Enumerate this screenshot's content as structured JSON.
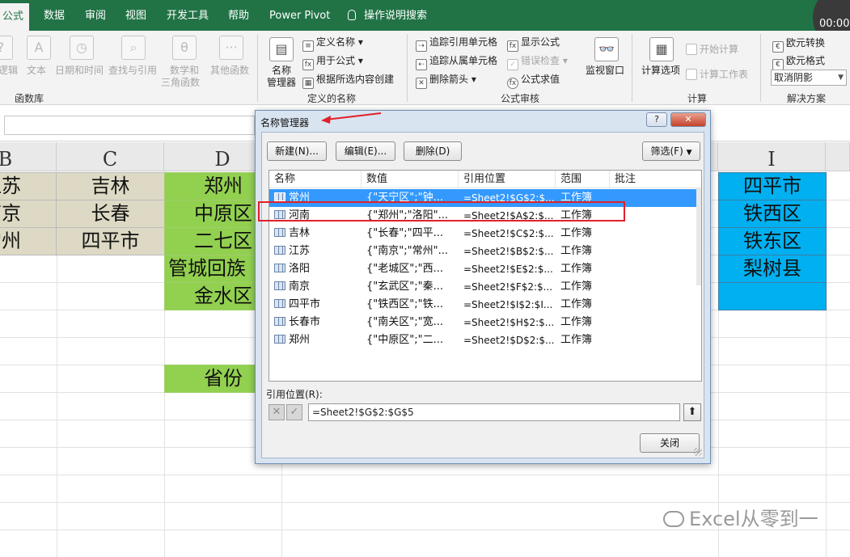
{
  "tabs": [
    {
      "label": "公式",
      "active": true
    },
    {
      "label": "数据"
    },
    {
      "label": "审阅"
    },
    {
      "label": "视图"
    },
    {
      "label": "开发工具"
    },
    {
      "label": "帮助"
    },
    {
      "label": "Power Pivot"
    },
    {
      "label": "操作说明搜索"
    }
  ],
  "timer": "00:00",
  "ribbon": {
    "function_library": {
      "group_label": "函数库",
      "logical": "逻辑",
      "text": "文本",
      "datetime": "日期和时间",
      "lookup": "查找与引用",
      "math": "数学和",
      "math2": "三角函数",
      "other": "其他函数"
    },
    "defined_names": {
      "group_label": "定义的名称",
      "name_manager": "名称",
      "name_manager2": "管理器",
      "define_name": "定义名称",
      "use_in_formula": "用于公式",
      "create_from_selection": "根据所选内容创建"
    },
    "formula_auditing": {
      "group_label": "公式审核",
      "trace_precedents": "追踪引用单元格",
      "trace_dependents": "追踪从属单元格",
      "remove_arrows": "删除箭头",
      "show_formulas": "显示公式",
      "error_checking": "错误检查",
      "evaluate_formula": "公式求值",
      "watch_window": "监视窗口"
    },
    "calculation": {
      "group_label": "计算",
      "calc_options": "计算选项",
      "calc_now": "开始计算",
      "calc_sheet": "计算工作表"
    },
    "solutions": {
      "group_label": "解决方案",
      "euro_convert": "欧元转换",
      "euro_format": "欧元格式",
      "cancel_shadow": "取消阴影"
    }
  },
  "sheet": {
    "columns": [
      "B",
      "C",
      "D",
      "I"
    ],
    "col_b": [
      "江苏",
      "南京",
      "常州"
    ],
    "col_c": [
      "吉林",
      "长春",
      "四平市"
    ],
    "col_d": [
      "郑州",
      "中原区",
      "二七区",
      "管城回族",
      "金水区"
    ],
    "col_i": [
      "四平市",
      "铁西区",
      "铁东区",
      "梨树县"
    ],
    "province_label": "省份",
    "colors": {
      "tan": "#ddd9c4",
      "green": "#92d050",
      "blue": "#00b0f0"
    }
  },
  "watermark": "Excel从零到一",
  "dialog": {
    "title": "名称管理器",
    "help": "?",
    "close": "✕",
    "new_btn": "新建(N)...",
    "edit_btn": "编辑(E)...",
    "delete_btn": "删除(D)",
    "filter_btn": "筛选(F)",
    "headers": {
      "name": "名称",
      "value": "数值",
      "refers": "引用位置",
      "scope": "范围",
      "comment": "批注"
    },
    "rows": [
      {
        "name": "常州",
        "value": "{\"天宁区\";\"钟...",
        "refers": "=Sheet2!$G$2:$...",
        "scope": "工作簿",
        "selected": true
      },
      {
        "name": "河南",
        "value": "{\"郑州\";\"洛阳\"...",
        "refers": "=Sheet2!$A$2:$...",
        "scope": "工作簿"
      },
      {
        "name": "吉林",
        "value": "{\"长春\";\"四平...",
        "refers": "=Sheet2!$C$2:$...",
        "scope": "工作簿"
      },
      {
        "name": "江苏",
        "value": "{\"南京\";\"常州\"...",
        "refers": "=Sheet2!$B$2:$...",
        "scope": "工作簿"
      },
      {
        "name": "洛阳",
        "value": "{\"老城区\";\"西...",
        "refers": "=Sheet2!$E$2:$...",
        "scope": "工作簿"
      },
      {
        "name": "南京",
        "value": "{\"玄武区\";\"秦...",
        "refers": "=Sheet2!$F$2:$...",
        "scope": "工作簿"
      },
      {
        "name": "四平市",
        "value": "{\"铁西区\";\"铁...",
        "refers": "=Sheet2!$I$2:$I...",
        "scope": "工作簿"
      },
      {
        "name": "长春市",
        "value": "{\"南关区\";\"宽...",
        "refers": "=Sheet2!$H$2:$...",
        "scope": "工作簿"
      },
      {
        "name": "郑州",
        "value": "{\"中原区\";\"二...",
        "refers": "=Sheet2!$D$2:$...",
        "scope": "工作簿"
      }
    ],
    "refers_label": "引用位置(R):",
    "refers_value": "=Sheet2!$G$2:$G$5",
    "close_btn": "关闭"
  }
}
